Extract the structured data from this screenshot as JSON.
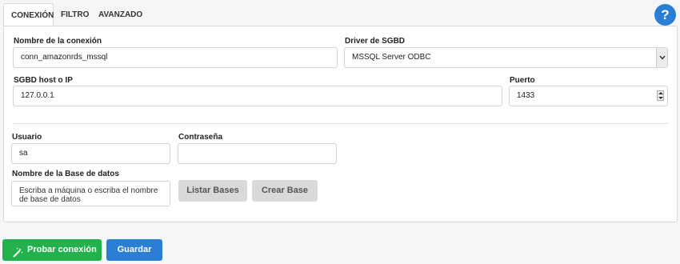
{
  "tabs": [
    {
      "label": "CONEXIÓN",
      "active": true
    },
    {
      "label": "FILTRO",
      "active": false
    },
    {
      "label": "AVANZADO",
      "active": false
    }
  ],
  "help": {
    "label": "?",
    "color": "#2a7fd4"
  },
  "connection": {
    "name_label": "Nombre de la conexión",
    "name_value": "conn_amazonrds_mssql",
    "driver_label": "Driver de SGBD",
    "driver_value": "MSSQL Server ODBC",
    "host_label": "SGBD host o IP",
    "host_value": "127.0.0.1",
    "port_label": "Puerto",
    "port_value": "1433",
    "user_label": "Usuario",
    "user_value": "sa",
    "password_label": "Contraseña",
    "password_value": "",
    "db_label": "Nombre de la Base de datos",
    "db_placeholder": "Escriba a máquina o escriba el nombre de base de datos"
  },
  "db_buttons": {
    "list": "Listar Bases",
    "create": "Crear Base"
  },
  "footer": {
    "test": "Probar conexión",
    "save": "Guardar"
  },
  "colors": {
    "test_button": "#22b14c",
    "save_button": "#2a7fd4"
  }
}
